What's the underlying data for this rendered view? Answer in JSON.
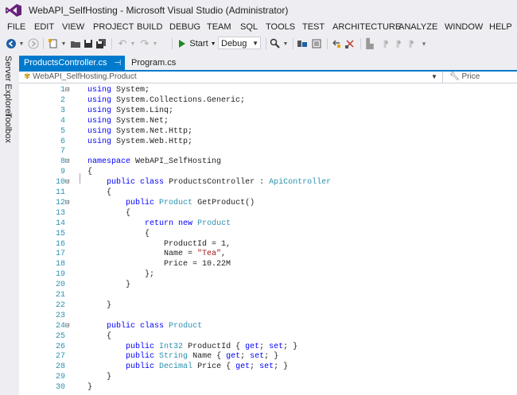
{
  "window": {
    "title": "WebAPI_SelfHosting - Microsoft Visual Studio (Administrator)"
  },
  "menu": [
    "FILE",
    "EDIT",
    "VIEW",
    "PROJECT",
    "BUILD",
    "DEBUG",
    "TEAM",
    "SQL",
    "TOOLS",
    "TEST",
    "ARCHITECTURE",
    "ANALYZE",
    "WINDOW",
    "HELP"
  ],
  "toolbar": {
    "start_label": "Start",
    "config_value": "Debug"
  },
  "side_tabs": [
    "Server Explorer",
    "Toolbox"
  ],
  "tabs": [
    {
      "label": "ProductsController.cs",
      "active": true
    },
    {
      "label": "Program.cs",
      "active": false
    }
  ],
  "navbar": {
    "class_path": "WebAPI_SelfHosting.Product",
    "member": "Price"
  },
  "colors": {
    "accent": "#007acc",
    "keyword": "#0000ff",
    "type": "#2b91af",
    "string": "#a31515"
  },
  "code_lines": [
    {
      "n": "1",
      "fold": "⊟",
      "text": "using System;"
    },
    {
      "n": "2",
      "fold": "",
      "text": "using System.Collections.Generic;"
    },
    {
      "n": "3",
      "fold": "",
      "text": "using System.Linq;"
    },
    {
      "n": "4",
      "fold": "",
      "text": "using System.Net;"
    },
    {
      "n": "5",
      "fold": "",
      "text": "using System.Net.Http;"
    },
    {
      "n": "6",
      "fold": "",
      "text": "using System.Web.Http;"
    },
    {
      "n": "7",
      "fold": "",
      "text": ""
    },
    {
      "n": "8",
      "fold": "⊟",
      "text": "namespace WebAPI_SelfHosting"
    },
    {
      "n": "9",
      "fold": "",
      "text": "{"
    },
    {
      "n": "10",
      "fold": "⊟",
      "text": "    public class ProductsController : ApiController"
    },
    {
      "n": "11",
      "fold": "",
      "text": "    {"
    },
    {
      "n": "12",
      "fold": "⊟",
      "text": "        public Product GetProduct()"
    },
    {
      "n": "13",
      "fold": "",
      "text": "        {"
    },
    {
      "n": "14",
      "fold": "",
      "text": "            return new Product"
    },
    {
      "n": "15",
      "fold": "",
      "text": "            {"
    },
    {
      "n": "16",
      "fold": "",
      "text": "                ProductId = 1,"
    },
    {
      "n": "17",
      "fold": "",
      "text": "                Name = \"Tea\","
    },
    {
      "n": "18",
      "fold": "",
      "text": "                Price = 10.22M"
    },
    {
      "n": "19",
      "fold": "",
      "text": "            };"
    },
    {
      "n": "20",
      "fold": "",
      "text": "        }"
    },
    {
      "n": "21",
      "fold": "",
      "text": ""
    },
    {
      "n": "22",
      "fold": "",
      "text": "    }"
    },
    {
      "n": "23",
      "fold": "",
      "text": ""
    },
    {
      "n": "24",
      "fold": "⊟",
      "text": "    public class Product"
    },
    {
      "n": "25",
      "fold": "",
      "text": "    {"
    },
    {
      "n": "26",
      "fold": "",
      "text": "        public Int32 ProductId { get; set; }"
    },
    {
      "n": "27",
      "fold": "",
      "text": "        public String Name { get; set; }"
    },
    {
      "n": "28",
      "fold": "",
      "text": "        public Decimal Price { get; set; }"
    },
    {
      "n": "29",
      "fold": "",
      "text": "    }"
    },
    {
      "n": "30",
      "fold": "",
      "text": "}"
    }
  ]
}
